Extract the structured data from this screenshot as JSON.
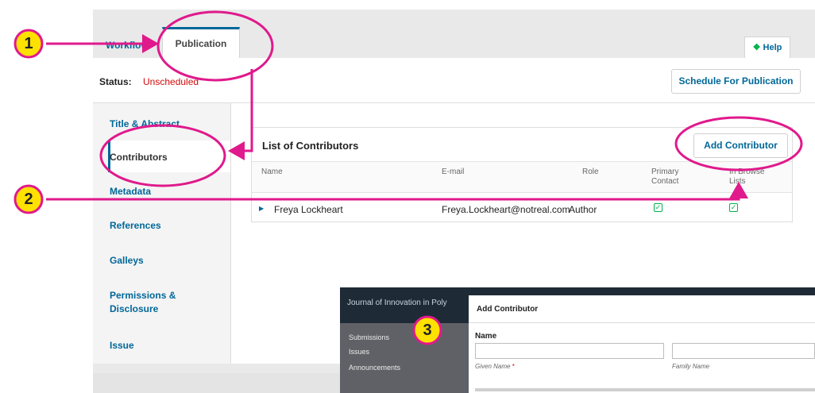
{
  "tabs": {
    "workflow": "Workflow",
    "publication": "Publication"
  },
  "help": {
    "icon": "info-icon",
    "label": "Help"
  },
  "status": {
    "label": "Status:",
    "value": "Unscheduled"
  },
  "schedule_button": "Schedule For Publication",
  "sidebar": {
    "items": [
      {
        "label": "Title & Abstract"
      },
      {
        "label": "Contributors"
      },
      {
        "label": "Metadata"
      },
      {
        "label": "References"
      },
      {
        "label": "Galleys"
      },
      {
        "label": "Permissions &"
      },
      {
        "label": "Disclosure"
      },
      {
        "label": "Issue"
      }
    ]
  },
  "contributors": {
    "title": "List of Contributors",
    "add_button": "Add Contributor",
    "columns": {
      "name": "Name",
      "email": "E-mail",
      "role": "Role",
      "primary_line1": "Primary",
      "primary_line2": "Contact",
      "browse_line1": "In Browse",
      "browse_line2": "Lists"
    },
    "rows": [
      {
        "name": "Freya Lockheart",
        "email": "Freya.Lockheart@notreal.com",
        "role": "Author"
      }
    ]
  },
  "inset": {
    "journal": "Journal of Innovation in Poly",
    "nav": [
      "Submissions",
      "Issues",
      "Announcements"
    ],
    "dialog_title": "Add Contributor",
    "name_label": "Name",
    "given_name_label": "Given Name",
    "required_marker": "*",
    "family_name_label": "Family Name"
  },
  "annotations": {
    "step1": "1",
    "step2": "2",
    "step3": "3"
  },
  "colors": {
    "accent": "#006798",
    "status_red": "#d00a0a",
    "check_green": "#00b24e",
    "annotation_magenta": "#e0198c",
    "badge_yellow": "#ffe100"
  }
}
